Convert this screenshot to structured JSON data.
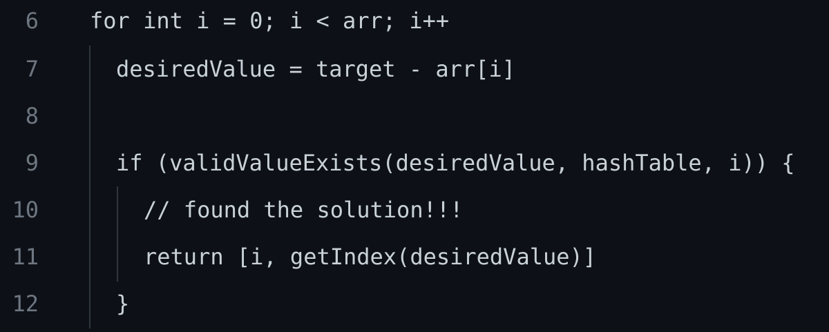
{
  "editor": {
    "line_numbers": [
      "6",
      "7",
      "8",
      "9",
      "10",
      "11",
      "12"
    ],
    "lines": [
      "for int i = 0; i < arr; i++",
      "desiredValue = target - arr[i]",
      "",
      "if (validValueExists(desiredValue, hashTable, i)) {",
      "// found the solution!!!",
      "return [i, getIndex(desiredValue)]",
      "}"
    ]
  }
}
